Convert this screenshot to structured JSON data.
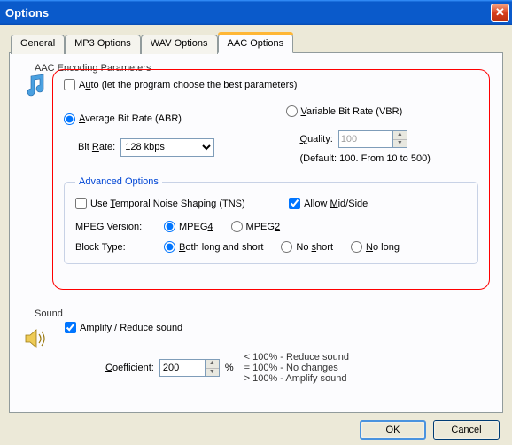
{
  "window": {
    "title": "Options"
  },
  "tabs": {
    "general": "General",
    "mp3": "MP3 Options",
    "wav": "WAV Options",
    "aac": "AAC Options"
  },
  "aac": {
    "group_title": "AAC Encoding Parameters",
    "auto_label_pre": "A",
    "auto_label_u": "u",
    "auto_label_post": "to (let the program choose the best parameters)",
    "abr_pre": "",
    "abr_u": "A",
    "abr_post": "verage Bit Rate (ABR)",
    "vbr_pre": "",
    "vbr_u": "V",
    "vbr_post": "ariable Bit Rate (VBR)",
    "bitrate_label_pre": "Bit ",
    "bitrate_label_u": "R",
    "bitrate_label_post": "ate:",
    "bitrate_value": "128 kbps",
    "quality_pre": "",
    "quality_u": "Q",
    "quality_post": "uality:",
    "quality_value": "100",
    "quality_help": "(Default: 100. From 10 to 500)",
    "adv_title": "Advanced Options",
    "tns_pre": "Use ",
    "tns_u": "T",
    "tns_post": "emporal Noise Shaping (TNS)",
    "mid_pre": "Allow ",
    "mid_u": "M",
    "mid_post": "id/Side",
    "mpeg_label": "MPEG Version:",
    "mpeg4_pre": "MPEG",
    "mpeg4_u": "4",
    "mpeg2_pre": "MPEG",
    "mpeg2_u": "2",
    "block_label": "Block Type:",
    "bt_both_pre": "",
    "bt_both_u": "B",
    "bt_both_post": "oth long and short",
    "bt_noshort_pre": "No ",
    "bt_noshort_u": "s",
    "bt_noshort_post": "hort",
    "bt_nolong_pre": "",
    "bt_nolong_u": "N",
    "bt_nolong_post": "o long"
  },
  "sound": {
    "group_title": "Sound",
    "amplify_pre": "Am",
    "amplify_u": "p",
    "amplify_post": "lify / Reduce sound",
    "coef_pre": "",
    "coef_u": "C",
    "coef_post": "oefficient:",
    "coef_value": "200",
    "pct": "%",
    "help1": "< 100% - Reduce sound",
    "help2": "= 100% - No changes",
    "help3": "> 100% - Amplify sound"
  },
  "buttons": {
    "ok": "OK",
    "cancel": "Cancel"
  }
}
